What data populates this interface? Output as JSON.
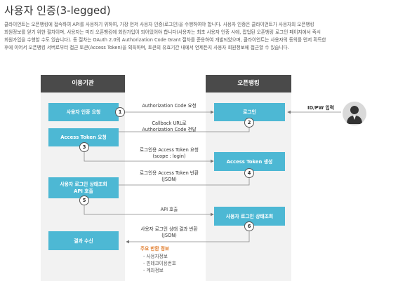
{
  "title": "사용자 인증(3-legged)",
  "description": [
    "클라이언트는 오픈뱅킹에 접속하여 API를 사용하기 위하여, 가장 먼저 사용자 인증(로그인)을 수행하여야 합니다. 사용자 인증은 클라이언트가 사용자의 오픈뱅킹",
    "회원정보를 얻기 위한 절차이며, 사용자는 미리 오픈뱅킹에 회원가입이 되어있어야 합니다(사용자는 최초 사용자 인증 시에, 팝업된 오픈뱅킹 로그인 페이지에서 즉시",
    "회원가입을 수행할 수도 있습니다). 동 절차는 OAuth 2.0의 Authorization Code Grant 절차를 준용하여 개발되었으며, 클라이언트는 사용자의 동의를 먼저 획득한",
    "후에 이어서 오픈뱅킹 서버로부터 접근 토큰(Access Token)을 획득하며, 토큰의 유효기간 내에서 언제든지 사용자 회원정보에 접근할 수 있습니다."
  ],
  "lanes": {
    "left": "이용기관",
    "right": "오픈뱅킹"
  },
  "boxes": {
    "user_auth_request": "사용자 인증 요청",
    "login": "로그인",
    "access_token_request": "Access Token 요청",
    "access_token_generate": "Access Token 생성",
    "user_login_status_call": "사용자 로그인 상태조회\nAPI 호출",
    "user_login_status_check": "사용자 로그인 상태조회",
    "result_receive": "결과 수신"
  },
  "steps": [
    "1",
    "2",
    "3",
    "4",
    "5",
    "6"
  ],
  "messages": {
    "m1": "Authorization Code 요청",
    "m2": "Callback URL로\nAuthorization Code 전달",
    "m3": "로그인용 Access Token 요청\n(scope : login)",
    "m4": "로그인용 Access Token 반환\n(JSON)",
    "m5": "API 호출",
    "m6": "사용자 로그인 상태 결과 반환\n(JSON)"
  },
  "user_input": "ID/PW 입력",
  "info": {
    "title": "주요 반환 정보",
    "items": [
      "- 사용자정보",
      "- 핀테크이용번호",
      "- 계좌정보"
    ]
  },
  "colors": {
    "box": "#4db8d4",
    "header": "#4a4a4a",
    "panel": "#f2f2f2",
    "accent": "#e07b2a"
  }
}
